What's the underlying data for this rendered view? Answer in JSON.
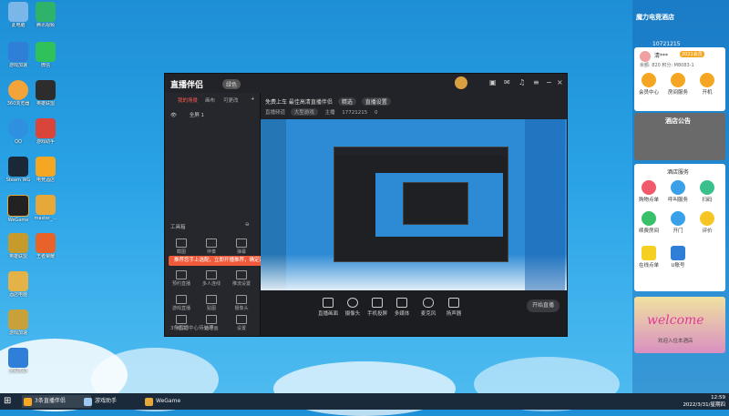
{
  "desktop": {
    "icons": [
      {
        "label": "此电脑",
        "color": "#7ab6e8"
      },
      {
        "label": "腾讯视频",
        "color": "#2fb36b"
      },
      {
        "label": "游戏加速",
        "color": "#2f7fd8"
      },
      {
        "label": "微信",
        "color": "#2fc25b"
      },
      {
        "label": "360浏览器",
        "color": "#f2a33a"
      },
      {
        "label": "英雄联盟",
        "color": "#2d2d2d"
      },
      {
        "label": "QQ",
        "color": "#2f8fe0"
      },
      {
        "label": "游戏助手",
        "color": "#d9453a"
      },
      {
        "label": "Steam WG",
        "color": "#1b2838"
      },
      {
        "label": "电竞酒店",
        "color": "#f5a623"
      },
      {
        "label": "WeGame",
        "color": "#222"
      },
      {
        "label": "master_...",
        "color": "#e7a83a"
      },
      {
        "label": "英雄联盟",
        "color": "#c79a2c"
      },
      {
        "label": "王者荣耀",
        "color": "#e8632a"
      },
      {
        "label": "酒店电脑",
        "color": "#e4b247"
      },
      {
        "label": "游戏加速",
        "color": "#c8a13a"
      },
      {
        "label": "远程协助",
        "color": "#2f7fd8"
      }
    ]
  },
  "app": {
    "logo": "直播伴侣",
    "badge": "绿色",
    "tabs": [
      "我的场景",
      "画布",
      "可更改"
    ],
    "scene_name": "全屏 1",
    "toolbox_label": "工具箱",
    "tools": [
      "截图",
      "伴奏",
      "弹幕",
      "预约直播",
      "多人连线",
      "推流设置",
      "游戏直播",
      "贴图",
      "摄像头",
      "旁白",
      "画中画",
      "设置"
    ],
    "banner": "推荐您手上选配，立即开播推荐，确定选品打开功能",
    "footer_hint": "3条直播中心待处理",
    "head_title": "免费上车 最佳高清直播伴侣",
    "head_pill1": "精选",
    "head_pill2": "直播设置",
    "head_row2": [
      "直播频道",
      "大型游戏",
      "主播",
      "17721215",
      "0"
    ],
    "bottom_items": [
      "直播画面",
      "摄像头",
      "手机投屏",
      "多媒体",
      "麦克风",
      "扬声器"
    ],
    "start_label": "开始直播"
  },
  "right_panel": {
    "brand": "魔力电竞酒店",
    "room_id": "10721215",
    "user_line": "清***",
    "vip": "2021会员",
    "stats": "余额: 820 积分: M8083-1",
    "grid1": [
      "会员中心",
      "房间服务",
      "开机"
    ],
    "notice_title": "酒店公告",
    "service_title": "酒店服务",
    "services": [
      "购物点单",
      "呼叫服务",
      "扫码",
      "续费房间",
      "开门",
      "评价",
      "在线点单",
      "U账号"
    ],
    "welcome": "welcome",
    "welcome_sub": "欢迎入住本酒店"
  },
  "taskbar": {
    "items": [
      "3条直播伴侣",
      "游戏助手",
      "WeGame"
    ],
    "time": "12:59",
    "date": "2022/3/31/星期四"
  }
}
